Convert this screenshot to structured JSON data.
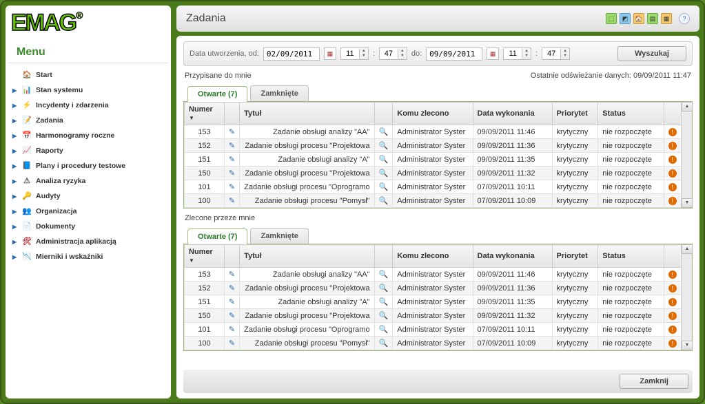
{
  "logo": "EMAG",
  "menu": {
    "title": "Menu",
    "items": [
      {
        "label": "Start",
        "icon": "home",
        "arrow": false
      },
      {
        "label": "Stan systemu",
        "icon": "state",
        "arrow": true
      },
      {
        "label": "Incydenty i zdarzenia",
        "icon": "incident",
        "arrow": true
      },
      {
        "label": "Zadania",
        "icon": "task",
        "arrow": true
      },
      {
        "label": "Harmonogramy roczne",
        "icon": "sched",
        "arrow": true
      },
      {
        "label": "Raporty",
        "icon": "report",
        "arrow": true
      },
      {
        "label": "Plany i procedury testowe",
        "icon": "plan",
        "arrow": true
      },
      {
        "label": "Analiza ryzyka",
        "icon": "risk",
        "arrow": true
      },
      {
        "label": "Audyty",
        "icon": "audit",
        "arrow": true
      },
      {
        "label": "Organizacja",
        "icon": "org",
        "arrow": true
      },
      {
        "label": "Dokumenty",
        "icon": "doc",
        "arrow": true
      },
      {
        "label": "Administracja aplikacją",
        "icon": "admin",
        "arrow": true
      },
      {
        "label": "Mierniki i wskaźniki",
        "icon": "metric",
        "arrow": true
      }
    ]
  },
  "header": {
    "title": "Zadania"
  },
  "filter": {
    "label_from": "Data utworzenia, od:",
    "date_from": "02/09/2011",
    "hour_from": "11",
    "sep": ":",
    "min_from": "47",
    "label_to": "do:",
    "date_to": "09/09/2011",
    "hour_to": "11",
    "min_to": "47",
    "search_btn": "Wyszukaj"
  },
  "refresh_label": "Ostatnie odświeżanie danych: 09/09/2011 11:47",
  "sections": {
    "assigned_label": "Przypisane do mnie",
    "ordered_label": "Zlecone przeze mnie"
  },
  "tabs": {
    "open": "Otwarte (7)",
    "closed": "Zamknięte"
  },
  "columns": {
    "num": "Numer",
    "title": "Tytuł",
    "who": "Komu zlecono",
    "date": "Data wykonania",
    "prio": "Priorytet",
    "stat": "Status"
  },
  "rows_assigned": [
    {
      "num": "153",
      "title": "Zadanie obsługi analizy \"AA\"",
      "who": "Administrator Syster",
      "date": "09/09/2011 11:46",
      "prio": "krytyczny",
      "stat": "nie rozpoczęte"
    },
    {
      "num": "152",
      "title": "Zadanie obsługi procesu \"Projektowa",
      "who": "Administrator Syster",
      "date": "09/09/2011 11:36",
      "prio": "krytyczny",
      "stat": "nie rozpoczęte"
    },
    {
      "num": "151",
      "title": "Zadanie obsługi analizy \"A\"",
      "who": "Administrator Syster",
      "date": "09/09/2011 11:35",
      "prio": "krytyczny",
      "stat": "nie rozpoczęte"
    },
    {
      "num": "150",
      "title": "Zadanie obsługi procesu \"Projektowa",
      "who": "Administrator Syster",
      "date": "09/09/2011 11:32",
      "prio": "krytyczny",
      "stat": "nie rozpoczęte"
    },
    {
      "num": "101",
      "title": "Zadanie obsługi procesu \"Oprogramo",
      "who": "Administrator Syster",
      "date": "07/09/2011 10:11",
      "prio": "krytyczny",
      "stat": "nie rozpoczęte"
    },
    {
      "num": "100",
      "title": "Zadanie obsługi procesu \"Pomysł\"",
      "who": "Administrator Syster",
      "date": "07/09/2011 10:09",
      "prio": "krytyczny",
      "stat": "nie rozpoczęte"
    }
  ],
  "rows_ordered": [
    {
      "num": "153",
      "title": "Zadanie obsługi analizy \"AA\"",
      "who": "Administrator Syster",
      "date": "09/09/2011 11:46",
      "prio": "krytyczny",
      "stat": "nie rozpoczęte"
    },
    {
      "num": "152",
      "title": "Zadanie obsługi procesu \"Projektowa",
      "who": "Administrator Syster",
      "date": "09/09/2011 11:36",
      "prio": "krytyczny",
      "stat": "nie rozpoczęte"
    },
    {
      "num": "151",
      "title": "Zadanie obsługi analizy \"A\"",
      "who": "Administrator Syster",
      "date": "09/09/2011 11:35",
      "prio": "krytyczny",
      "stat": "nie rozpoczęte"
    },
    {
      "num": "150",
      "title": "Zadanie obsługi procesu \"Projektowa",
      "who": "Administrator Syster",
      "date": "09/09/2011 11:32",
      "prio": "krytyczny",
      "stat": "nie rozpoczęte"
    },
    {
      "num": "101",
      "title": "Zadanie obsługi procesu \"Oprogramo",
      "who": "Administrator Syster",
      "date": "07/09/2011 10:11",
      "prio": "krytyczny",
      "stat": "nie rozpoczęte"
    },
    {
      "num": "100",
      "title": "Zadanie obsługi procesu \"Pomysł\"",
      "who": "Administrator Syster",
      "date": "07/09/2011 10:09",
      "prio": "krytyczny",
      "stat": "nie rozpoczęte"
    }
  ],
  "footer": {
    "close_btn": "Zamknij"
  },
  "icon_glyphs": {
    "home": "🏠",
    "state": "📊",
    "incident": "⚡",
    "task": "📝",
    "sched": "📅",
    "report": "📈",
    "plan": "📘",
    "risk": "⚠",
    "audit": "🔑",
    "org": "👥",
    "doc": "📄",
    "admin": "🛠",
    "metric": "📉"
  }
}
